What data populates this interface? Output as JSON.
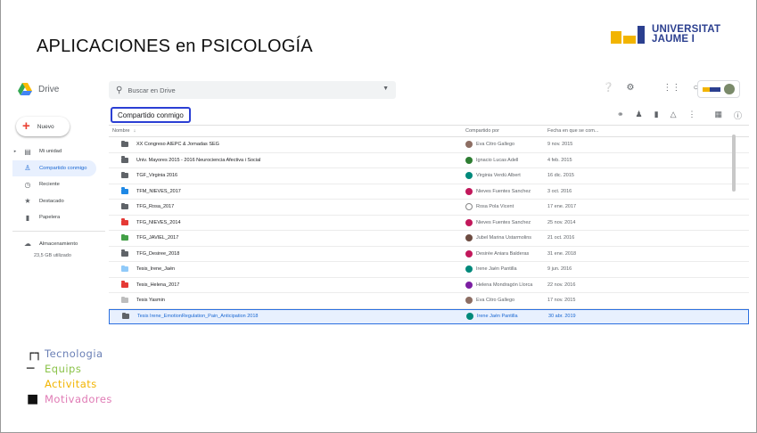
{
  "slide": {
    "title": "APLICACIONES en PSICOLOGÍA",
    "university_line1": "UNIVERSITAT",
    "university_line2": "JAUME I"
  },
  "colors": {
    "uji_yellow": "#f2b400",
    "uji_blue": "#2b3f8f",
    "highlight_border": "#2b3fd4",
    "drive_active": "#1967d2"
  },
  "drive": {
    "app_name": "Drive",
    "search_placeholder": "Buscar en Drive",
    "new_button": "Nuevo",
    "sidebar": [
      {
        "label": "Mi unidad",
        "icon": "my-drive-icon",
        "active": false
      },
      {
        "label": "Compartido conmigo",
        "icon": "shared-icon",
        "active": true
      },
      {
        "label": "Reciente",
        "icon": "clock-icon",
        "active": false
      },
      {
        "label": "Destacado",
        "icon": "star-icon",
        "active": false
      },
      {
        "label": "Papelera",
        "icon": "trash-icon",
        "active": false
      }
    ],
    "storage_label": "Almacenamiento",
    "storage_used": "23,5 GB utilizado",
    "section_title": "Compartido conmigo",
    "columns": {
      "name": "Nombre",
      "shared_by": "Compartido por",
      "date": "Fecha en que se com..."
    },
    "files": [
      {
        "name": "XX Congreso AIEPC & Jornadas SEG",
        "owner": "Eva Citro Gallego",
        "date": "9 nov. 2015",
        "folder_color": "#5f6368",
        "avatar": "#8d6e63"
      },
      {
        "name": "Univ. Mayores 2015 - 2016 Neurociencia Afectiva i Social",
        "owner": "Ignacio Lucas Adell",
        "date": "4 feb. 2015",
        "folder_color": "#5f6368",
        "avatar": "#2e7d32"
      },
      {
        "name": "TGF_Virginia 2016",
        "owner": "Virginia Verdú Albert",
        "date": "16 dic. 2015",
        "folder_color": "#5f6368",
        "avatar": "#00897b"
      },
      {
        "name": "TFM_NIEVES_2017",
        "owner": "Nieves Fuentes Sanchez",
        "date": "3 oct. 2016",
        "folder_color": "#1e88e5",
        "avatar": "#c2185b"
      },
      {
        "name": "TFG_Rosa_2017",
        "owner": "Rosa Pola Vicent",
        "date": "17 ene. 2017",
        "folder_color": "#5f6368",
        "avatar": "#ffffff"
      },
      {
        "name": "TFG_NIEVES_2014",
        "owner": "Nieves Fuentes Sanchez",
        "date": "25 nov. 2014",
        "folder_color": "#e53935",
        "avatar": "#c2185b"
      },
      {
        "name": "TFG_JAVIEL_2017",
        "owner": "Jubel Marina Ustarmolins",
        "date": "21 oct. 2016",
        "folder_color": "#43a047",
        "avatar": "#6d4c41"
      },
      {
        "name": "TFG_Desiree_2018",
        "owner": "Desirée Aniara Balderas",
        "date": "31 ene. 2018",
        "folder_color": "#5f6368",
        "avatar": "#c2185b"
      },
      {
        "name": "Tesis_Irene_Jaén",
        "owner": "Irene Jaén Pantilla",
        "date": "9 jun. 2016",
        "folder_color": "#90caf9",
        "avatar": "#00897b"
      },
      {
        "name": "Tesis_Helena_2017",
        "owner": "Helena Mondragón Llorca",
        "date": "22 nov. 2016",
        "folder_color": "#e53935",
        "avatar": "#7b1fa2"
      },
      {
        "name": "Tesis Yasmin",
        "owner": "Eva Citro Gallego",
        "date": "17 nov. 2015",
        "folder_color": "#bdbdbd",
        "avatar": "#8d6e63"
      },
      {
        "name": "Tesis Irene_EmotionRegulation_Pain_Anticipation 2018",
        "owner": "Irene Jaén Pantilla",
        "date": "30 abr. 2019",
        "folder_color": "#5f6368",
        "avatar": "#00897b",
        "selected": true
      }
    ]
  },
  "gem": {
    "line1": "Tecnologia",
    "line2": "Equips",
    "line3": "Activitats",
    "line4": "Motivadores",
    "colors": [
      "#6a7fb5",
      "#8bc34a",
      "#f2b400",
      "#e07bb5"
    ]
  }
}
